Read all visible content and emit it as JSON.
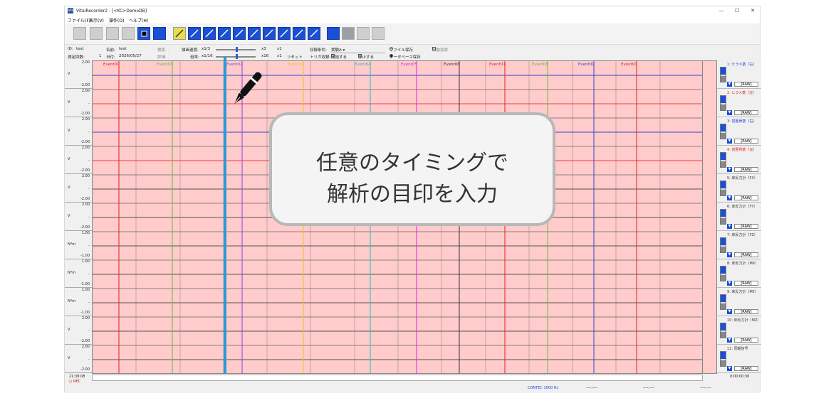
{
  "window": {
    "title": "VitalRecorder2 - [<KC>DemoDB]",
    "app_icon": "VR",
    "controls": [
      "—",
      "☐",
      "✕"
    ]
  },
  "menu": [
    "ファイル(F)",
    "表示(V)",
    "操作(O)",
    "ヘルプ(H)"
  ],
  "info": {
    "id_label": "ID:",
    "id_value": "test",
    "name_label": "名前:",
    "name_value": "test",
    "search_button": "検索...",
    "count_label": "測定回数:",
    "count_value": "1",
    "date_label": "日付:",
    "date_value": "2026/05/27",
    "detail_button": "詳細...",
    "draw_speed_label": "描画速度:",
    "draw_speed_min": "x1/3",
    "draw_speed_max": "x3",
    "draw_speed_value": "x1",
    "scale_label": "倍率:",
    "scale_min": "x1/16",
    "scale_max": "x16",
    "scale_value": "x1",
    "reset_button": "リセット",
    "rec_condition_label": "収録条件:",
    "rec_condition_value": "実験A",
    "trigger_label": "トリガ収録:",
    "trigger_start": "開始する",
    "trigger_stop": "停止する",
    "file_save": "ファイル保存",
    "db_save": "データベース保存",
    "auto_search": "自動探索"
  },
  "events": [
    "Event00",
    "Event01",
    "Event02",
    "Event03",
    "Event04",
    "Event05",
    "Event06",
    "Event07",
    "Event08",
    "Event09",
    "Event00"
  ],
  "rows": [
    {
      "top": "2.00",
      "bottom": "-2.00",
      "unit": "V"
    },
    {
      "top": "2.00",
      "bottom": "-2.00",
      "unit": "V"
    },
    {
      "top": "2.00",
      "bottom": "-2.00",
      "unit": "V"
    },
    {
      "top": "2.00",
      "bottom": "-2.00",
      "unit": "V"
    },
    {
      "top": "2.00",
      "bottom": "-2.00",
      "unit": "V"
    },
    {
      "top": "2.00",
      "bottom": "-2.00",
      "unit": "V"
    },
    {
      "top": "1.00",
      "bottom": "-1.00",
      "unit": "N*m"
    },
    {
      "top": "1.00",
      "bottom": "-1.00",
      "unit": "N*m"
    },
    {
      "top": "1.00",
      "bottom": "-1.00",
      "unit": "N*m"
    },
    {
      "top": "2.00",
      "bottom": "-2.00",
      "unit": "V"
    },
    {
      "top": "2.00",
      "bottom": "-2.00",
      "unit": "V"
    }
  ],
  "channels": [
    {
      "name": "1: ヒラメ筋（右）",
      "color": "#1a3fd0",
      "raw": "[RAW]"
    },
    {
      "name": "2: ヒラメ筋（左）",
      "color": "#e02020",
      "raw": "[RAW]"
    },
    {
      "name": "3: 前脛骨筋（右）",
      "color": "#1a3fd0",
      "raw": "[RAW]"
    },
    {
      "name": "4: 前脛骨筋（左）",
      "color": "#e02020",
      "raw": "[RAW]"
    },
    {
      "name": "5: 床反力計（FX）",
      "color": "#333333",
      "raw": "[RAW]"
    },
    {
      "name": "6: 床反力計（FY）",
      "color": "#333333",
      "raw": "[RAW]"
    },
    {
      "name": "7: 床反力計（FZ）",
      "color": "#333333",
      "raw": "[RAW]"
    },
    {
      "name": "8: 床反力計（MX）",
      "color": "#333333",
      "raw": "[RAW]"
    },
    {
      "name": "9: 床反力計（MY）",
      "color": "#333333",
      "raw": "[RAW]"
    },
    {
      "name": "10: 床反力計（MZ）",
      "color": "#333333",
      "raw": "[RAW]"
    },
    {
      "name": "11: 同期信号",
      "color": "#333333",
      "raw": "[RAW]"
    }
  ],
  "status": {
    "time": "21:38:08",
    "rec": "REC",
    "elapsed": "0:00:00:30",
    "device": "CONTEC 1000 Hz",
    "f1": "----:----",
    "f2": "----:----",
    "f3": "----:----"
  },
  "callout": {
    "line1": "任意のタイミングで",
    "line2": "解析の目印を入力"
  },
  "colors": {
    "plot_bg": "#ffcbcb",
    "marker": "#2a9ad6",
    "toolbar_blue": "#1a4fd6"
  }
}
